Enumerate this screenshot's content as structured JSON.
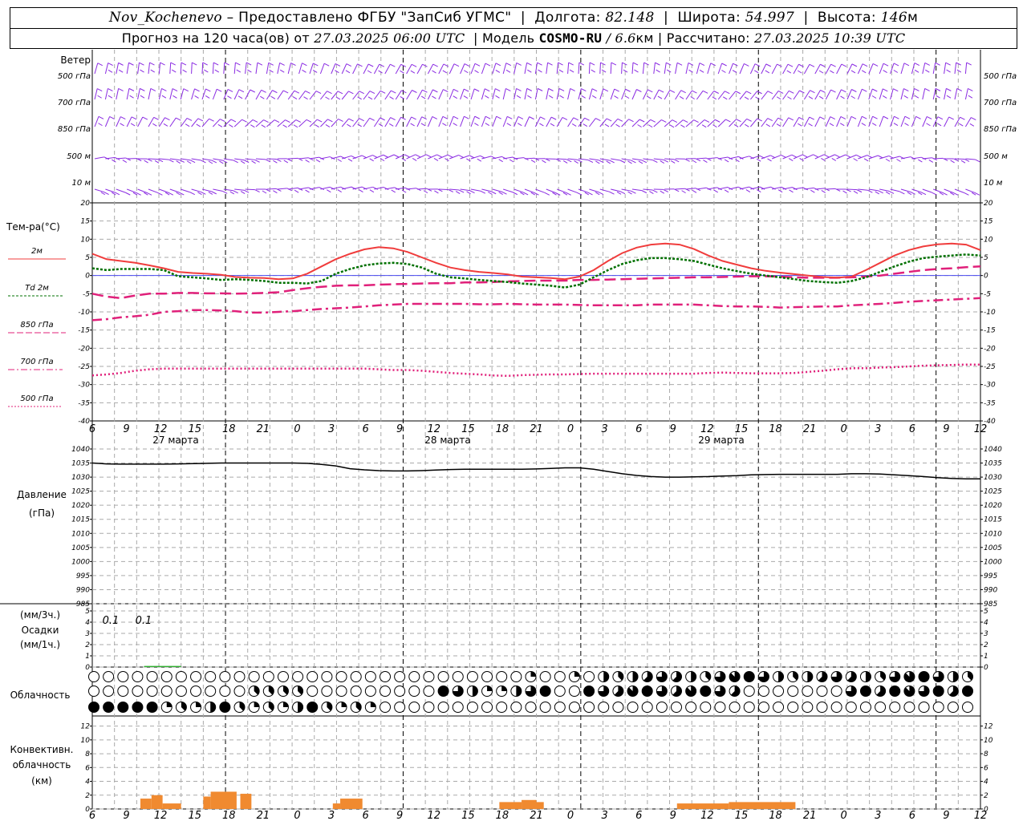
{
  "header": {
    "station": "Nov_Kochenevo",
    "provided_by": "– Предоставлено ФГБУ \"ЗапСиб УГМС\"",
    "lon_label": "Долгота:",
    "lon": "82.148",
    "lat_label": "Широта:",
    "lat": "54.997",
    "alt_label": "Высота:",
    "alt": "146",
    "alt_unit": "м",
    "forecast_label": "Прогноз на 120 часа(ов) от",
    "forecast_from": "27.03.2025 06:00 UTC",
    "model_label": "Модель",
    "model": "COSMO-RU",
    "model_res": "/ 6.6",
    "model_res_unit": "км",
    "calc_label": "Рассчитано:",
    "calc_time": "27.03.2025 10:39 UTC"
  },
  "labels": {
    "wind_title": "Ветер",
    "wind_levels": [
      "500 гПа",
      "700 гПа",
      "850 гПа",
      "500 м",
      "10  м"
    ],
    "temp_title": "Тем-ра(°С)",
    "temp_legend": [
      "2м",
      "Td  2м",
      "850 гПа",
      "700 гПа",
      "500 гПа"
    ],
    "pressure_title": "Давление",
    "pressure_unit": "(гПа)",
    "precip_units1": "(мм/3ч.)",
    "precip_title": "Осадки",
    "precip_units2": "(мм/1ч.)",
    "cloud_title": "Облачность",
    "conv_title1": "Конвективн.",
    "conv_title2": "облачность",
    "conv_unit": "(км)"
  },
  "colors": {
    "wind": "#8a2be2",
    "t2m": "#f03c3c",
    "td2m": "#007000",
    "t850": "#e0207a",
    "t700": "#e0207a",
    "t500": "#e0207a",
    "pressure": "#000000",
    "precip": "#30b030",
    "conv": "#f08a30",
    "zero_line": "#4a4af0"
  },
  "chart_data": {
    "type": "line",
    "x_ticks": [
      "6",
      "9",
      "12",
      "15",
      "18",
      "21",
      "0",
      "3",
      "6",
      "9",
      "12",
      "15",
      "18",
      "21",
      "0",
      "3",
      "6",
      "9",
      "12",
      "15",
      "18",
      "21",
      "0",
      "3",
      "6",
      "9",
      "12"
    ],
    "day_labels": [
      "27 марта",
      "28 марта",
      "29 марта"
    ],
    "temperature": {
      "ylim": [
        -40,
        20
      ],
      "ticks": [
        20,
        15,
        10,
        5,
        0,
        -5,
        -10,
        -15,
        -20,
        -25,
        -30,
        -35,
        -40
      ],
      "series": [
        {
          "name": "2м",
          "values": [
            6,
            4.5,
            4,
            3.5,
            2.8,
            2,
            1,
            0.7,
            0.5,
            0.2,
            -0.4,
            -0.6,
            -0.7,
            -1,
            -0.8,
            0.5,
            2.5,
            4.5,
            6,
            7.2,
            7.8,
            7.5,
            6.5,
            5,
            3.5,
            2.2,
            1.5,
            1,
            0.7,
            0.3,
            -0.3,
            -0.5,
            -0.7,
            -1,
            -0.3,
            1.5,
            4,
            6.2,
            7.7,
            8.5,
            8.8,
            8.5,
            7.3,
            5.5,
            4,
            3,
            2,
            1.3,
            0.8,
            0.4,
            0,
            -0.4,
            -0.6,
            -0.3,
            1.5,
            3.5,
            5.5,
            7,
            8,
            8.6,
            8.8,
            8.5,
            7
          ]
        },
        {
          "name": "Td  2м",
          "values": [
            2,
            1.5,
            1.8,
            1.8,
            1.8,
            1.5,
            -0.2,
            -0.5,
            -0.8,
            -1.2,
            -1,
            -1.2,
            -1.5,
            -2,
            -2,
            -2.2,
            -1.5,
            0.5,
            1.8,
            2.8,
            3.3,
            3.5,
            3.2,
            2.2,
            0.5,
            -0.5,
            -0.8,
            -1.2,
            -1.5,
            -1.8,
            -2.2,
            -2.5,
            -2.8,
            -3.3,
            -2.5,
            -0.5,
            1.5,
            3.2,
            4.2,
            4.8,
            4.8,
            4.5,
            4,
            3,
            2,
            1.2,
            0.5,
            0,
            -0.5,
            -1,
            -1.5,
            -1.8,
            -2,
            -1.5,
            -0.5,
            1,
            2.5,
            3.8,
            4.8,
            5.2,
            5.5,
            5.8,
            5.5
          ]
        },
        {
          "name": "850 гПа",
          "values": [
            -5,
            -5.8,
            -6.2,
            -5.5,
            -5,
            -5,
            -4.8,
            -4.8,
            -4.9,
            -4.9,
            -5,
            -4.9,
            -4.8,
            -4.6,
            -4,
            -3.5,
            -3.1,
            -2.8,
            -2.7,
            -2.7,
            -2.5,
            -2.4,
            -2.3,
            -2.2,
            -2.1,
            -2.1,
            -1.9,
            -1.9,
            -1.8,
            -1.6,
            -1.5,
            -1.4,
            -1.4,
            -1.4,
            -1.2,
            -1.2,
            -1.1,
            -1,
            -0.9,
            -0.8,
            -0.7,
            -0.6,
            -0.5,
            -0.5,
            -0.4,
            -0.3,
            -0.2,
            -0.2,
            -0.3,
            -0.5,
            -0.6,
            -0.6,
            -0.6,
            -0.5,
            -0.3,
            0,
            0.5,
            1,
            1.5,
            1.8,
            2,
            2.3,
            2.5
          ]
        },
        {
          "name": "700 гПа",
          "values": [
            -12.3,
            -12,
            -11.5,
            -11.2,
            -10.8,
            -10,
            -9.8,
            -9.5,
            -9.5,
            -9.6,
            -9.8,
            -10.2,
            -10.2,
            -10,
            -9.8,
            -9.5,
            -9.2,
            -9,
            -8.8,
            -8.5,
            -8.2,
            -8,
            -7.8,
            -7.8,
            -7.8,
            -7.8,
            -7.8,
            -7.9,
            -7.9,
            -7.8,
            -7.9,
            -8,
            -8,
            -8,
            -8.1,
            -8.2,
            -8.2,
            -8.2,
            -8.2,
            -8,
            -8,
            -8,
            -8,
            -8.2,
            -8.4,
            -8.5,
            -8.5,
            -8.6,
            -8.8,
            -8.7,
            -8.6,
            -8.5,
            -8.5,
            -8.2,
            -8,
            -7.8,
            -7.5,
            -7.2,
            -7,
            -6.8,
            -6.6,
            -6.4,
            -6.2
          ]
        },
        {
          "name": "500 гПа",
          "values": [
            -27.5,
            -27.2,
            -26.8,
            -26.2,
            -25.8,
            -25.6,
            -25.6,
            -25.6,
            -25.6,
            -25.6,
            -25.6,
            -25.6,
            -25.6,
            -25.6,
            -25.6,
            -25.6,
            -25.6,
            -25.6,
            -25.6,
            -25.6,
            -25.8,
            -26,
            -26,
            -26.2,
            -26.5,
            -26.8,
            -27,
            -27.2,
            -27.5,
            -27.6,
            -27.4,
            -27.3,
            -27.2,
            -27.2,
            -27.1,
            -27,
            -27,
            -27,
            -27,
            -27,
            -27,
            -27,
            -27,
            -26.8,
            -26.7,
            -26.8,
            -26.9,
            -26.9,
            -26.9,
            -26.8,
            -26.5,
            -26.2,
            -25.8,
            -25.5,
            -25.5,
            -25.3,
            -25.2,
            -25,
            -24.8,
            -24.7,
            -24.6,
            -24.5,
            -24.5
          ]
        }
      ]
    },
    "pressure": {
      "ylim": [
        985,
        1040
      ],
      "ticks": [
        1040,
        1035,
        1030,
        1025,
        1020,
        1015,
        1010,
        1005,
        1000,
        995,
        990,
        985
      ],
      "values": [
        1035,
        1034.7,
        1034.6,
        1034.6,
        1034.6,
        1034.6,
        1034.7,
        1034.8,
        1034.9,
        1035,
        1035,
        1035,
        1035,
        1035,
        1035,
        1034.9,
        1034.5,
        1034,
        1033,
        1032.6,
        1032.3,
        1032.2,
        1032.2,
        1032.3,
        1032.5,
        1032.7,
        1032.8,
        1032.8,
        1032.8,
        1032.8,
        1032.8,
        1032.9,
        1033.1,
        1033.3,
        1033.3,
        1032.8,
        1032,
        1031.2,
        1030.6,
        1030.2,
        1030,
        1030,
        1030.1,
        1030.2,
        1030.4,
        1030.5,
        1030.8,
        1030.9,
        1031,
        1031,
        1031,
        1031,
        1031,
        1031.2,
        1031.2,
        1031.1,
        1030.8,
        1030.5,
        1030.2,
        1029.8,
        1029.5,
        1029.4,
        1029.4
      ]
    },
    "precipitation": {
      "ylim": [
        0,
        5
      ],
      "ticks": [
        5,
        4,
        3,
        2,
        1,
        0
      ],
      "annotations": [
        {
          "label": "0.1",
          "x": 8
        },
        {
          "label": "0.1",
          "x": 11
        }
      ],
      "bars": [
        {
          "from": 7,
          "to": 9,
          "value": 0.1
        },
        {
          "from": 9,
          "to": 12,
          "value": 0.1
        }
      ]
    },
    "cloudiness_levels": [
      "upper",
      "middle",
      "lower"
    ],
    "convective": {
      "ylim": [
        0,
        13
      ],
      "ticks": [
        12,
        10,
        8,
        6,
        4,
        2,
        0
      ],
      "segments": [
        {
          "from": 6.5,
          "to": 8,
          "top": 1.5
        },
        {
          "from": 8,
          "to": 9.5,
          "top": 2
        },
        {
          "from": 9.5,
          "to": 12,
          "top": 0.8
        },
        {
          "from": 15,
          "to": 16,
          "top": 1.8
        },
        {
          "from": 16,
          "to": 19.5,
          "top": 2.5
        },
        {
          "from": 20,
          "to": 21.5,
          "top": 2.2
        },
        {
          "from": 32.5,
          "to": 33.5,
          "top": 0.8
        },
        {
          "from": 33.5,
          "to": 36.5,
          "top": 1.5
        },
        {
          "from": 55,
          "to": 58,
          "top": 1
        },
        {
          "from": 58,
          "to": 60,
          "top": 1.3
        },
        {
          "from": 60,
          "to": 61,
          "top": 1
        },
        {
          "from": 79,
          "to": 86,
          "top": 0.8
        },
        {
          "from": 86,
          "to": 95,
          "top": 1
        }
      ]
    }
  }
}
